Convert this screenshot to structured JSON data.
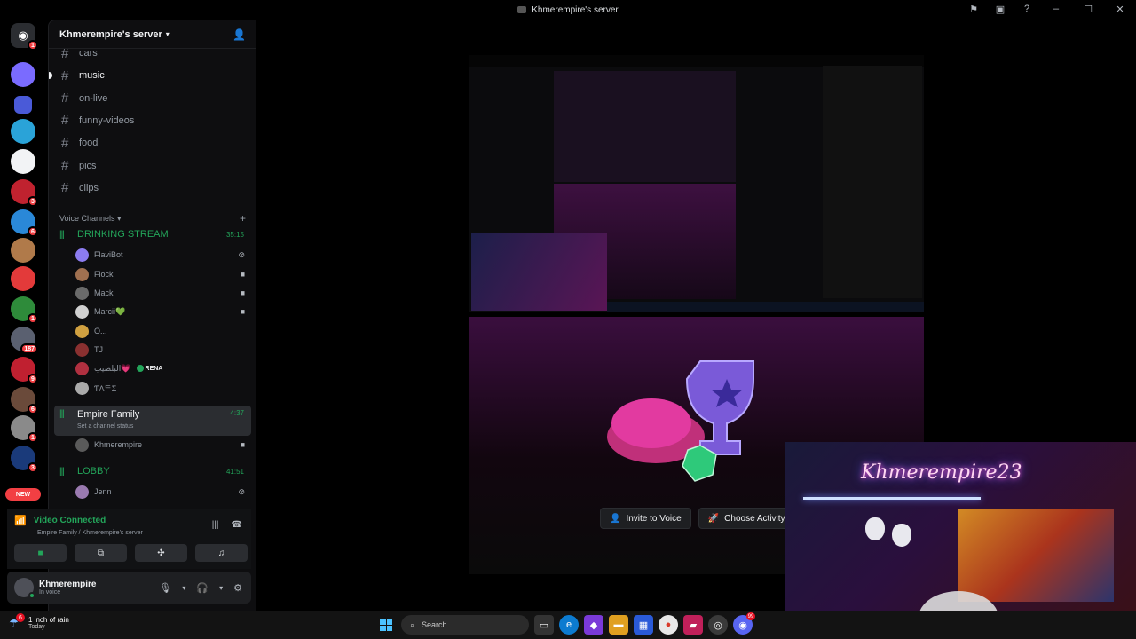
{
  "window": {
    "title": "Khmerempire's server"
  },
  "rail": {
    "home_badge": "1",
    "servers": [
      {
        "color": "#7a6bff",
        "badge": ""
      },
      {
        "color": "#4a5ad8",
        "badge": ""
      },
      {
        "color": "#2aa3d8",
        "badge": ""
      },
      {
        "color": "#f2f3f5",
        "badge": ""
      },
      {
        "color": "#c0222f",
        "badge": "3"
      },
      {
        "color": "#2a88d8",
        "badge": "6"
      },
      {
        "color": "#b07a4a",
        "badge": ""
      },
      {
        "color": "#e33a3a",
        "badge": ""
      },
      {
        "color": "#2e8b3a",
        "badge": "1"
      },
      {
        "color": "#5a6070",
        "badge": "187"
      },
      {
        "color": "#c02030",
        "badge": "9"
      },
      {
        "color": "#6a4a3a",
        "badge": "6"
      },
      {
        "color": "#8a8a8a",
        "badge": "1"
      },
      {
        "color": "#1a3a7a",
        "badge": "3"
      }
    ],
    "new_label": "NEW"
  },
  "sidebar": {
    "guild_name": "Khmerempire's server",
    "text_channels": [
      "cars",
      "music",
      "on-live",
      "funny-videos",
      "food",
      "pics",
      "clips"
    ],
    "voice_header": "Voice Channels",
    "voice_channels": [
      {
        "name": "DRINKING STREAM",
        "time": "35:15",
        "users": [
          {
            "name": "FlaviBot",
            "color": "#8c7cf0",
            "icon": "no-video"
          },
          {
            "name": "Flock",
            "color": "#a07050",
            "icon": "camera"
          },
          {
            "name": "Mack",
            "color": "#6a6a6a",
            "icon": "camera"
          },
          {
            "name": "Marcii💚",
            "color": "#d0d0d0",
            "icon": "camera"
          },
          {
            "name": "O...",
            "color": "#d0a040",
            "icon": ""
          },
          {
            "name": "TJ",
            "color": "#8a3030",
            "icon": ""
          },
          {
            "name": "البلصيب💗",
            "color": "#b03040",
            "icon": "",
            "tag": "RENA"
          },
          {
            "name": "ƬΛᄃΣ",
            "color": "#aaaaaa",
            "icon": ""
          }
        ]
      },
      {
        "name": "Empire Family",
        "time": "4:37",
        "status": "Set a channel status",
        "users": [
          {
            "name": "Khmerempire",
            "color": "#5a5a5a",
            "icon": "camera"
          }
        ]
      },
      {
        "name": "LOBBY",
        "time": "41:51",
        "users": [
          {
            "name": "Jenn",
            "color": "#9a7ab0",
            "icon": "deafened"
          }
        ]
      }
    ]
  },
  "voice_panel": {
    "title": "Video Connected",
    "subtitle": "Empire Family / Khmerempire's server"
  },
  "user_panel": {
    "name": "Khmerempire",
    "status": "In voice"
  },
  "main": {
    "invite_label": "Invite to Voice",
    "activity_label": "Choose Activity",
    "webcam_text": "Khmerempire23"
  },
  "taskbar": {
    "weather_badge": "6",
    "weather_line1": "1 inch of rain",
    "weather_line2": "Today",
    "search_placeholder": "Search",
    "discord_badge": "99"
  }
}
